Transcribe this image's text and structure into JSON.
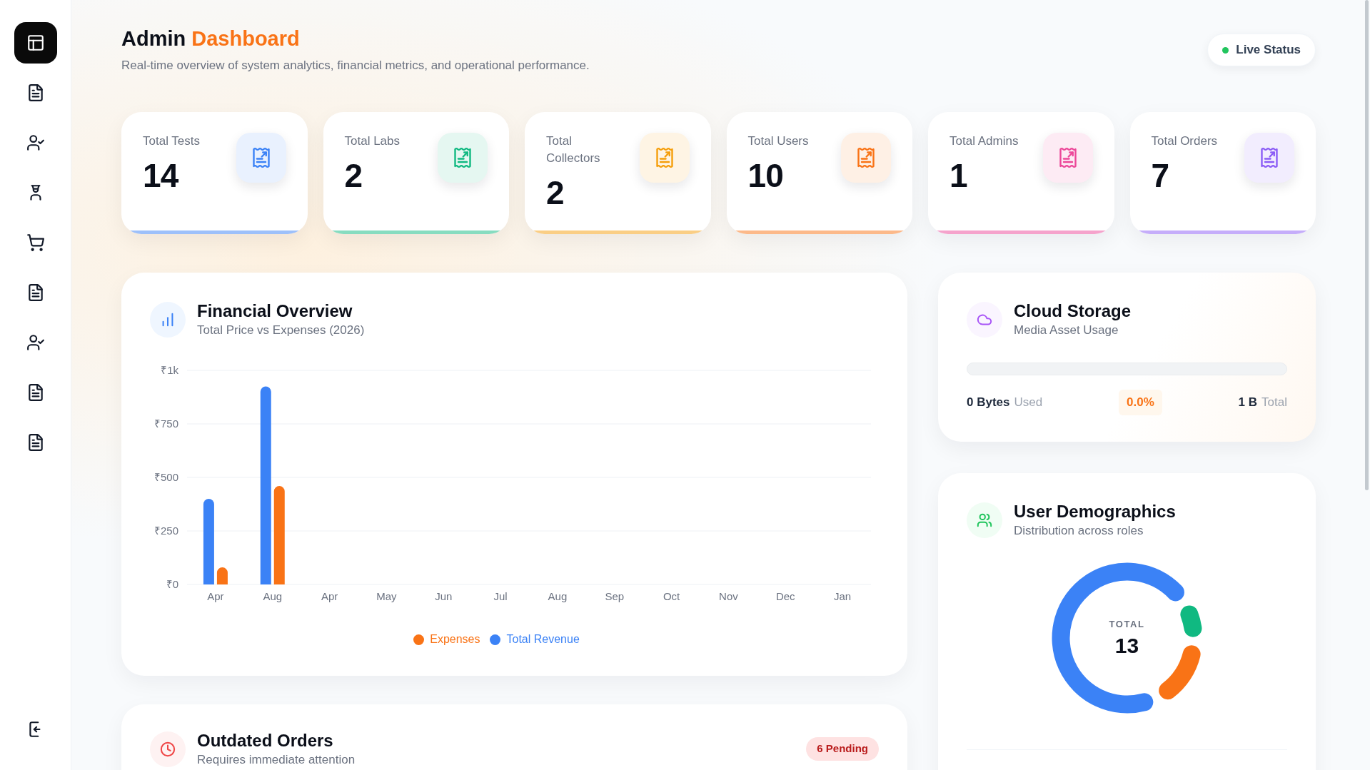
{
  "sidebar": {
    "items": [
      {
        "kind": "layout",
        "selected": true
      },
      {
        "kind": "document",
        "selected": false
      },
      {
        "kind": "user-check",
        "selected": false
      },
      {
        "kind": "person-cap",
        "selected": false
      },
      {
        "kind": "cart",
        "selected": false
      },
      {
        "kind": "document",
        "selected": false
      },
      {
        "kind": "user-check",
        "selected": false
      },
      {
        "kind": "document",
        "selected": false
      },
      {
        "kind": "document",
        "selected": false
      }
    ],
    "footer_items": [
      {
        "kind": "logout",
        "selected": false
      }
    ]
  },
  "header": {
    "title": "Admin",
    "title_accent": "Dashboard",
    "subtitle": "Real-time overview of system analytics, financial metrics, and operational performance.",
    "status": {
      "label": "Live Status",
      "on": true
    }
  },
  "stats": [
    {
      "label": "Total Tests",
      "value": "14",
      "color": "#3b82f6"
    },
    {
      "label": "Total Labs",
      "value": "2",
      "color": "#10b981"
    },
    {
      "label": "Total Collectors",
      "value": "2",
      "color": "#f59e0b"
    },
    {
      "label": "Total Users",
      "value": "10",
      "color": "#f97316"
    },
    {
      "label": "Total Admins",
      "value": "1",
      "color": "#ec4899"
    },
    {
      "label": "Total Orders",
      "value": "7",
      "color": "#8b5cf6"
    }
  ],
  "financial_overview": {
    "title": "Financial Overview",
    "subtitle": "Total Price vs Expenses (2026)",
    "chart_data": {
      "type": "bar",
      "categories": [
        "Apr",
        "Aug",
        "Apr",
        "May",
        "Jun",
        "Jul",
        "Aug",
        "Sep",
        "Oct",
        "Nov",
        "Dec",
        "Jan"
      ],
      "series": [
        {
          "name": "Total Revenue",
          "color": "#3b82f6",
          "values": [
            400,
            925,
            0,
            0,
            0,
            0,
            0,
            0,
            0,
            0,
            0,
            0
          ]
        },
        {
          "name": "Expenses",
          "color": "#f97316",
          "values": [
            80,
            460,
            0,
            0,
            0,
            0,
            0,
            0,
            0,
            0,
            0,
            0
          ]
        }
      ],
      "ylim": [
        0,
        1000
      ],
      "yticks": [
        {
          "value": 0,
          "label": "₹0"
        },
        {
          "value": 250,
          "label": "₹250"
        },
        {
          "value": 500,
          "label": "₹500"
        },
        {
          "value": 750,
          "label": "₹750"
        },
        {
          "value": 1000,
          "label": "₹1k"
        }
      ],
      "grid": true,
      "legend": "bottom"
    }
  },
  "outdated_orders": {
    "title": "Outdated Orders",
    "subtitle": "Requires immediate attention",
    "badge": "6 Pending"
  },
  "cloud_storage": {
    "title": "Cloud Storage",
    "subtitle": "Media Asset Usage",
    "level": 0,
    "used": {
      "value": "0 Bytes",
      "label": "Used"
    },
    "percent": "0.0%",
    "total": {
      "value": "1 B",
      "label": "Total"
    }
  },
  "user_demographics": {
    "title": "User Demographics",
    "subtitle": "Distribution across roles",
    "chart_data": {
      "type": "donut",
      "values": [
        7.7,
        76.9,
        15.4
      ],
      "colors": [
        "#10b981",
        "#3b82f6",
        "#f97316"
      ]
    },
    "center_label": "TOTAL",
    "center_value": "13"
  }
}
